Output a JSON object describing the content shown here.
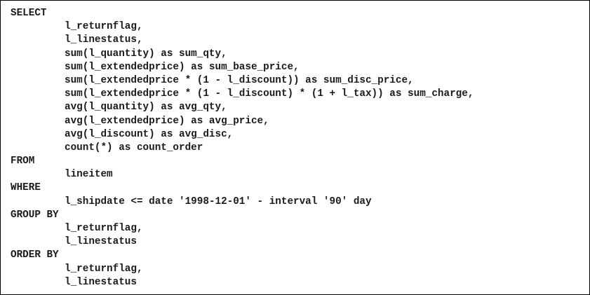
{
  "sql": {
    "lines": [
      {
        "text": "SELECT",
        "indent": false
      },
      {
        "text": "l_returnflag,",
        "indent": true
      },
      {
        "text": "l_linestatus,",
        "indent": true
      },
      {
        "text": "sum(l_quantity) as sum_qty,",
        "indent": true
      },
      {
        "text": "sum(l_extendedprice) as sum_base_price,",
        "indent": true
      },
      {
        "text": "sum(l_extendedprice * (1 - l_discount)) as sum_disc_price,",
        "indent": true
      },
      {
        "text": "sum(l_extendedprice * (1 - l_discount) * (1 + l_tax)) as sum_charge,",
        "indent": true
      },
      {
        "text": "avg(l_quantity) as avg_qty,",
        "indent": true
      },
      {
        "text": "avg(l_extendedprice) as avg_price,",
        "indent": true
      },
      {
        "text": "avg(l_discount) as avg_disc,",
        "indent": true
      },
      {
        "text": "count(*) as count_order",
        "indent": true
      },
      {
        "text": "FROM",
        "indent": false
      },
      {
        "text": "lineitem",
        "indent": true
      },
      {
        "text": "WHERE",
        "indent": false
      },
      {
        "text": "l_shipdate <= date '1998-12-01' - interval '90' day",
        "indent": true
      },
      {
        "text": "GROUP BY",
        "indent": false
      },
      {
        "text": "l_returnflag,",
        "indent": true
      },
      {
        "text": "l_linestatus",
        "indent": true
      },
      {
        "text": "ORDER BY",
        "indent": false
      },
      {
        "text": "l_returnflag,",
        "indent": true
      },
      {
        "text": "l_linestatus",
        "indent": true
      }
    ]
  }
}
